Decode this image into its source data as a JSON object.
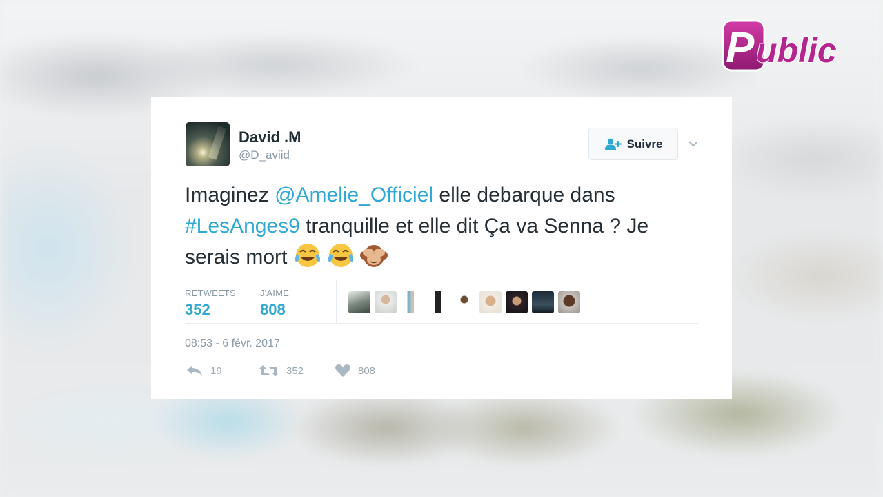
{
  "brand": {
    "logo_text": "Public",
    "colors": {
      "logo": "#b3268f",
      "link": "#2fa8d4"
    }
  },
  "tweet": {
    "author_name": "David .M",
    "author_handle": "@D_aviid",
    "follow_label": "Suivre",
    "text_part1": "Imaginez ",
    "mention": "@Amelie_Officiel",
    "text_part2": " elle debarque dans ",
    "hashtag": "#LesAnges9",
    "text_part3": " tranquille et elle dit Ça va Senna ? Je serais mort ",
    "emojis": [
      "face-with-tears-of-joy",
      "face-with-tears-of-joy",
      "see-no-evil-monkey"
    ],
    "retweets_label": "RETWEETS",
    "retweets_count": "352",
    "likes_label": "J'AIME",
    "likes_count": "808",
    "liker_avatars": 9,
    "timestamp": "08:53 - 6 févr. 2017",
    "actions": {
      "reply_count": "19",
      "retweet_count": "352",
      "like_count": "808"
    }
  }
}
